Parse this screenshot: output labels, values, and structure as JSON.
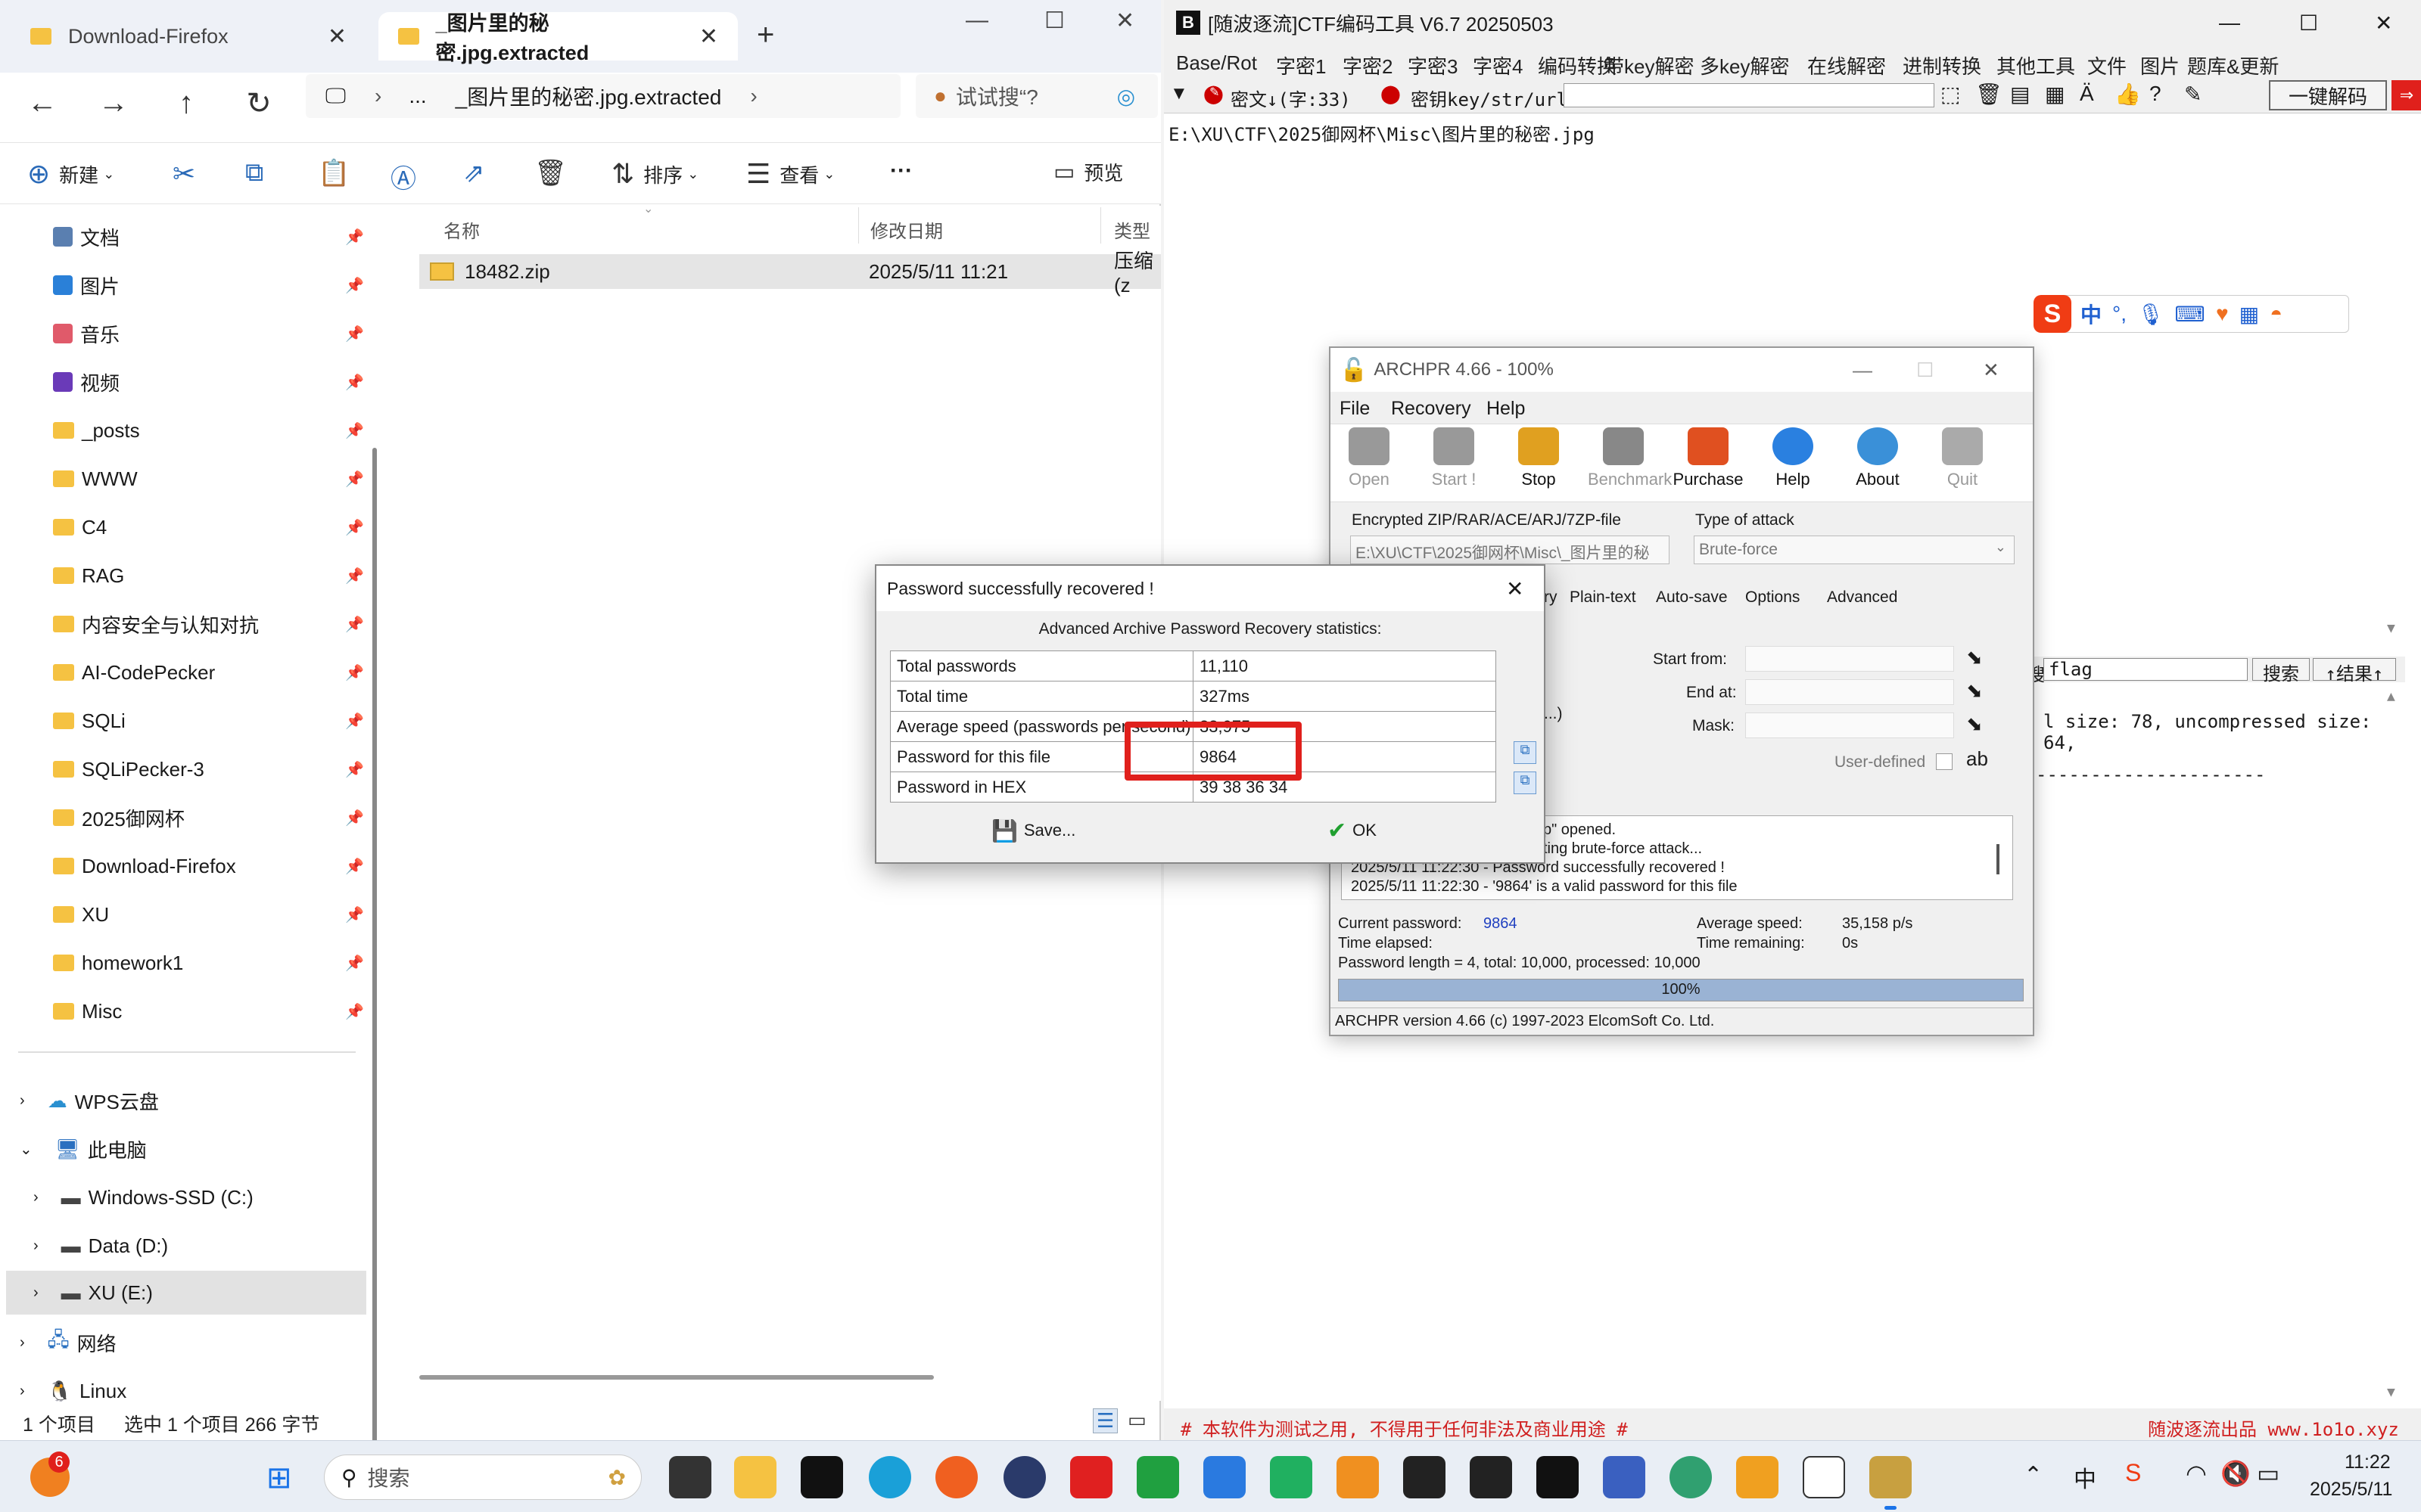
{
  "explorer": {
    "tabs": [
      {
        "label": "Download-Firefox"
      },
      {
        "label": "_图片里的秘密.jpg.extracted"
      }
    ],
    "address_segments": [
      "...",
      "_图片里的秘密.jpg.extracted"
    ],
    "search_placeholder": "试试搜“?",
    "commands": {
      "new": "新建",
      "sort": "排序",
      "view": "查看",
      "more": "···",
      "preview": "预览"
    },
    "sidebar": {
      "quick_access": [
        {
          "label": "文档"
        },
        {
          "label": "图片"
        },
        {
          "label": "音乐"
        },
        {
          "label": "视频"
        },
        {
          "label": "_posts"
        },
        {
          "label": "WWW"
        },
        {
          "label": "C4"
        },
        {
          "label": "RAG"
        },
        {
          "label": "内容安全与认知对抗"
        },
        {
          "label": "AI-CodePecker"
        },
        {
          "label": "SQLi"
        },
        {
          "label": "SQLiPecker-3"
        },
        {
          "label": "2025御网杯"
        },
        {
          "label": "Download-Firefox"
        },
        {
          "label": "XU"
        },
        {
          "label": "homework1"
        },
        {
          "label": "Misc"
        }
      ],
      "wps": "WPS云盘",
      "this_pc": "此电脑",
      "drives": [
        {
          "label": "Windows-SSD (C:)"
        },
        {
          "label": "Data (D:)"
        },
        {
          "label": "XU (E:)"
        }
      ],
      "network": "网络",
      "linux": "Linux"
    },
    "columns": {
      "name": "名称",
      "modified": "修改日期",
      "type": "类型"
    },
    "files": [
      {
        "name": "18482.zip",
        "modified": "2025/5/11 11:21",
        "type": "压缩(z"
      }
    ],
    "status": {
      "count": "1 个项目",
      "selected": "选中 1 个项目  266 字节"
    }
  },
  "ctf": {
    "title": "[随波逐流]CTF编码工具 V6.7  20250503",
    "menu": [
      "Base/Rot",
      "字密1",
      "字密2",
      "字密3",
      "字密4",
      "编码转换",
      "带key解密",
      "多key解密",
      "在线解密",
      "进制转换",
      "其他工具",
      "文件",
      "图片",
      "题库&更新"
    ],
    "cipher_label": "密文↓(字:33)",
    "key_label": "密钥key/str/url:",
    "one_click": "一键解码",
    "text_line1": "E:\\XU\\CTF\\2025御网杯\\Misc\\图片里的秘密.jpg",
    "search_value": "flag",
    "search_btn": "搜索",
    "result_btn": "↑结果↑",
    "output_line1": "l size: 78, uncompressed size: 64,",
    "output_line2": "---------------------",
    "footer_left": "# 本软件为测试之用, 不得用于任何非法及商业用途 #",
    "footer_right": "随波逐流出品 www.1o1o.xyz"
  },
  "archpr": {
    "title": "ARCHPR 4.66 - 100%",
    "menu": [
      "File",
      "Recovery",
      "Help"
    ],
    "toolbar": [
      "Open",
      "Start !",
      "Stop",
      "Benchmark",
      "Purchase",
      "Help",
      "About",
      "Quit"
    ],
    "encrypted_label": "Encrypted ZIP/RAR/ACE/ARJ/7ZP-file",
    "file_path": "E:\\XU\\CTF\\2025御网杯\\Misc\\_图片里的秘",
    "attack_label": "Type of attack",
    "attack_value": "Brute-force",
    "tabs": [
      "ry",
      "Plain-text",
      "Auto-save",
      "Options",
      "Advanced"
    ],
    "start_from": "Start from:",
    "end_at": "End at:",
    "mask": "Mask:",
    "user_defined": "User-defined",
    "paren": "...)",
    "log": [
      "p\" opened.",
      "ting brute-force attack...",
      "2025/5/11 11:22:30 - Password successfully recovered !",
      "2025/5/11 11:22:30 - '9864' is a valid password for this file"
    ],
    "current_password_label": "Current password:",
    "current_password": "9864",
    "time_elapsed_label": "Time elapsed:",
    "avg_speed_label": "Average speed:",
    "avg_speed": "35,158 p/s",
    "time_remaining_label": "Time remaining:",
    "time_remaining": "0s",
    "summary": "Password length = 4, total: 10,000, processed: 10,000",
    "progress_label": "100%",
    "progress": 1.0,
    "footer": "ARCHPR version 4.66 (c) 1997-2023 ElcomSoft Co. Ltd."
  },
  "dialog": {
    "title": "Password successfully recovered !",
    "heading": "Advanced Archive Password Recovery statistics:",
    "rows": [
      {
        "label": "Total passwords",
        "value": "11,110"
      },
      {
        "label": "Total time",
        "value": "327ms"
      },
      {
        "label": "Average speed (passwords per second)",
        "value": "33,975"
      },
      {
        "label": "Password for this file",
        "value": "9864"
      },
      {
        "label": "Password in HEX",
        "value": "39 38 36 34"
      }
    ],
    "save": "Save...",
    "ok": "OK"
  },
  "ime": {
    "lang": "中",
    "punct": "°,"
  },
  "taskbar": {
    "search": "搜索",
    "badge": "6",
    "ime": "中",
    "time": "11:22",
    "date": "2025/5/11"
  },
  "colors": {
    "accent": "#0067c0",
    "highlight_box": "#e0201c",
    "progress": "#9ab3d4",
    "folder": "#f5c242"
  }
}
